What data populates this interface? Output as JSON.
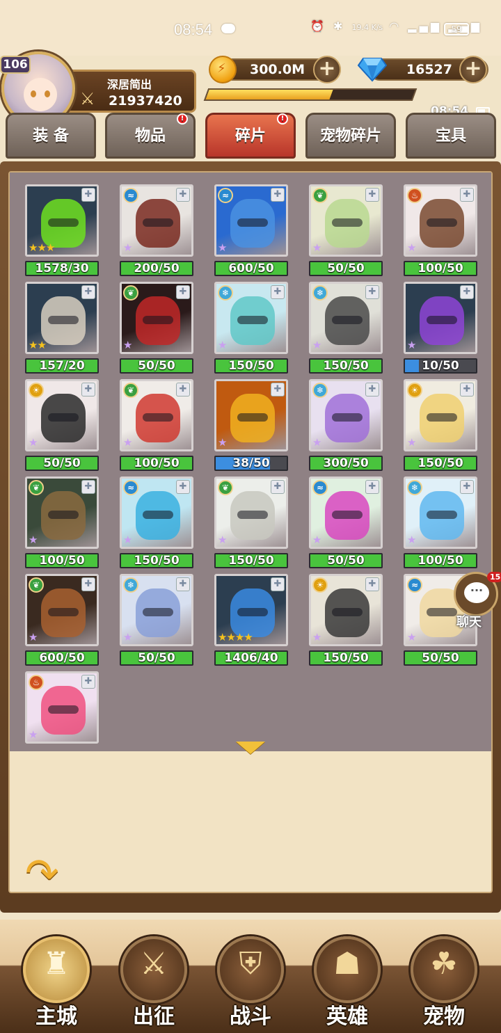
{
  "status_bar": {
    "time": "08:54",
    "network_speed": "19.4 K/s",
    "battery": "59"
  },
  "player": {
    "level": "106",
    "name": "深居简出",
    "power": "21937420"
  },
  "resources": {
    "gold": "300.0M",
    "gems": "16527",
    "xp_fraction": 0.6
  },
  "clock": "08:54",
  "tabs": [
    {
      "label": "装 备",
      "active": false,
      "badge": false
    },
    {
      "label": "物品",
      "active": false,
      "badge": true
    },
    {
      "label": "碎片",
      "active": true,
      "badge": true
    },
    {
      "label": "宠物碎片",
      "active": false,
      "badge": false
    },
    {
      "label": "宝具",
      "active": false,
      "badge": false
    }
  ],
  "fragments": [
    {
      "count": "1578/30",
      "stars": 3,
      "element": null,
      "art": "green-helmet",
      "fill": 1.0
    },
    {
      "count": "200/50",
      "stars": 1,
      "element": "water",
      "art": "gunner",
      "fill": 1.0
    },
    {
      "count": "600/50",
      "stars": 1,
      "element": "water",
      "art": "shark",
      "fill": 1.0
    },
    {
      "count": "50/50",
      "stars": 1,
      "element": "nature",
      "art": "green-hair-girl",
      "fill": 1.0
    },
    {
      "count": "100/50",
      "stars": 1,
      "element": "fire",
      "art": "brown-hair-girl",
      "fill": 1.0
    },
    {
      "count": "157/20",
      "stars": 2,
      "element": null,
      "art": "white-helmet",
      "fill": 1.0
    },
    {
      "count": "50/50",
      "stars": 1,
      "element": "nature",
      "art": "red-dragon",
      "fill": 1.0
    },
    {
      "count": "150/50",
      "stars": 1,
      "element": "ice",
      "art": "teal-hair-girl",
      "fill": 1.0
    },
    {
      "count": "150/50",
      "stars": 1,
      "element": "ice",
      "art": "dark-knight",
      "fill": 1.0
    },
    {
      "count": "10/50",
      "stars": 1,
      "element": null,
      "art": "purple-helmet",
      "fill": 0.2
    },
    {
      "count": "50/50",
      "stars": 1,
      "element": "light",
      "art": "black-hair-girl",
      "fill": 1.0
    },
    {
      "count": "100/50",
      "stars": 1,
      "element": "nature",
      "art": "red-green-boy",
      "fill": 1.0
    },
    {
      "count": "38/50",
      "stars": 1,
      "element": null,
      "art": "gold-helmet",
      "fill": 0.76
    },
    {
      "count": "300/50",
      "stars": 1,
      "element": "ice",
      "art": "purple-hair-girl",
      "fill": 1.0
    },
    {
      "count": "150/50",
      "stars": 1,
      "element": "light",
      "art": "blonde-elf",
      "fill": 1.0
    },
    {
      "count": "100/50",
      "stars": 1,
      "element": "nature",
      "art": "cat-warrior",
      "fill": 1.0
    },
    {
      "count": "150/50",
      "stars": 1,
      "element": "water",
      "art": "blue-hair-girl",
      "fill": 1.0
    },
    {
      "count": "150/50",
      "stars": 1,
      "element": "nature",
      "art": "white-hair-girl",
      "fill": 1.0
    },
    {
      "count": "50/50",
      "stars": 1,
      "element": "water",
      "art": "pink-hair-girl",
      "fill": 1.0
    },
    {
      "count": "100/50",
      "stars": 1,
      "element": "ice",
      "art": "light-blue-girl",
      "fill": 1.0
    },
    {
      "count": "600/50",
      "stars": 1,
      "element": "nature",
      "art": "wolf",
      "fill": 1.0
    },
    {
      "count": "50/50",
      "stars": 1,
      "element": "ice",
      "art": "silver-hair-boy",
      "fill": 1.0
    },
    {
      "count": "1406/40",
      "stars": 4,
      "element": null,
      "art": "blue-helmet",
      "fill": 1.0
    },
    {
      "count": "150/50",
      "stars": 1,
      "element": "light",
      "art": "nun",
      "fill": 1.0
    },
    {
      "count": "50/50",
      "stars": 1,
      "element": "water",
      "art": "blonde-girl",
      "fill": 1.0
    },
    {
      "count": "",
      "stars": 1,
      "element": "fire",
      "art": "pink-clown",
      "fill": 0
    }
  ],
  "chat": {
    "label": "聊天",
    "unread": "15"
  },
  "bottom_nav": [
    {
      "label": "主城",
      "icon": "castle-icon",
      "glyph": "♜",
      "active": true
    },
    {
      "label": "出征",
      "icon": "axes-icon",
      "glyph": "⚔",
      "active": false
    },
    {
      "label": "战斗",
      "icon": "shield-swords-icon",
      "glyph": "⛨",
      "active": false
    },
    {
      "label": "英雄",
      "icon": "hooded-hero-icon",
      "glyph": "☗",
      "active": false
    },
    {
      "label": "宠物",
      "icon": "dragon-pet-icon",
      "glyph": "☘",
      "active": false
    }
  ],
  "colors": {
    "bar_green": "#49c43d",
    "bar_blue": "#3c8ee0",
    "star": "#f5c21e",
    "star_purple": "#c9a0f0",
    "active_tab": "#c8422e"
  }
}
